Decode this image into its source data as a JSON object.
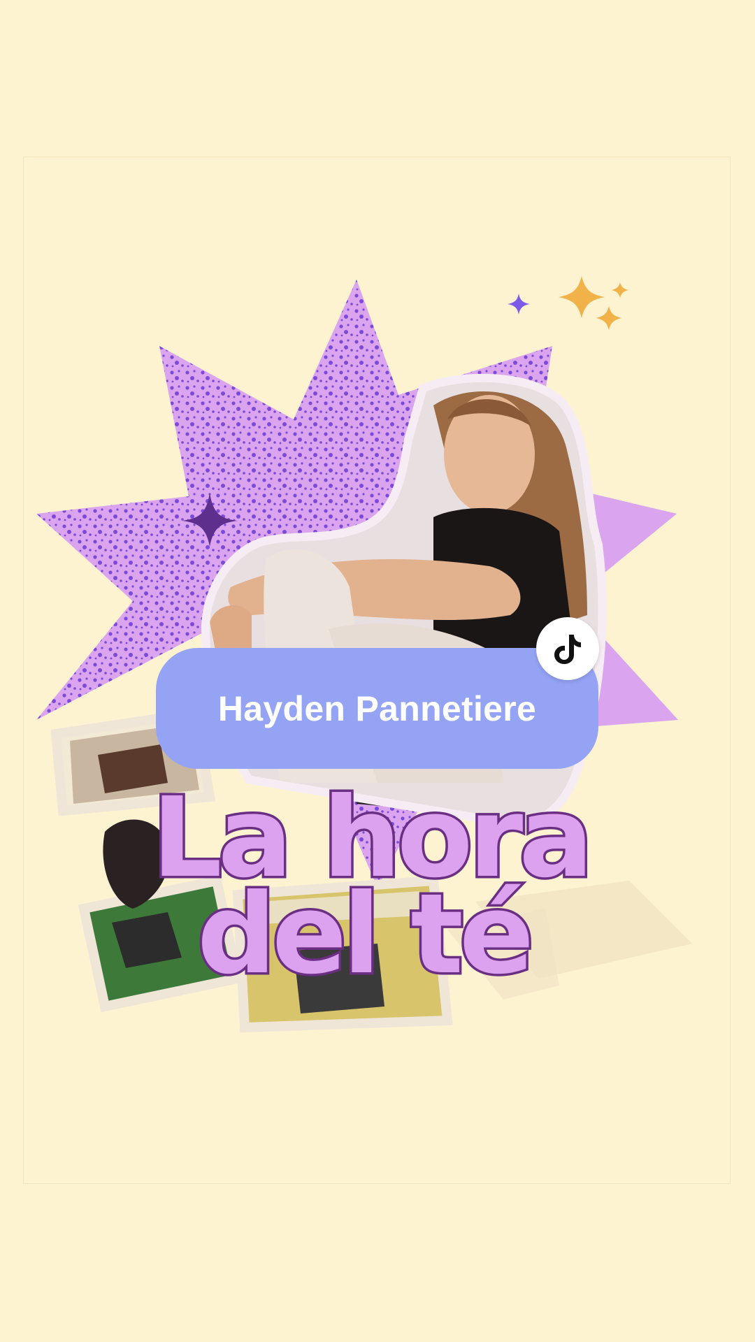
{
  "profile": {
    "name": "Hayden Pannetiere",
    "platform_icon": "tiktok-icon"
  },
  "title": {
    "line1": "La hora",
    "line2": "del té"
  },
  "colors": {
    "background": "#fdf3d1",
    "starburst": "#dba4ee",
    "starburst_speckle": "#7b4ad9",
    "name_pill": "#95a3f5",
    "title_fill": "#dda2ef",
    "title_outline": "#6a2e83",
    "sparkle_gold": "#f2b24a",
    "sparkle_purple": "#7d5be8"
  }
}
